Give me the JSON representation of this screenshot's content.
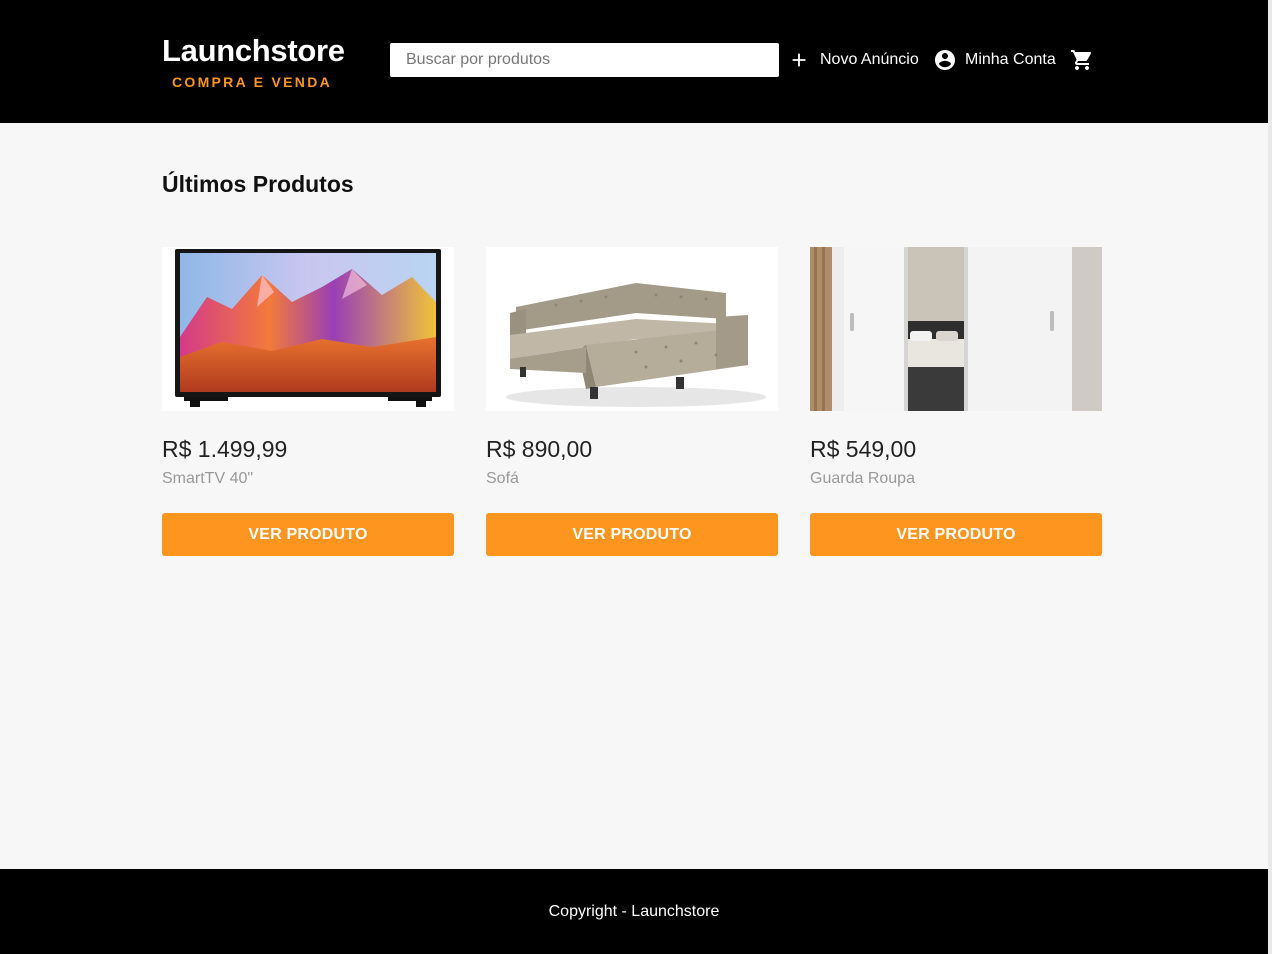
{
  "header": {
    "brand_title": "Launchstore",
    "brand_subtitle": "COMPRA E VENDA",
    "search_placeholder": "Buscar por produtos",
    "new_ad_label": "Novo Anúncio",
    "account_label": "Minha Conta",
    "icons": {
      "new_ad": "plus-icon",
      "account": "account-circle-icon",
      "cart": "cart-icon"
    }
  },
  "main": {
    "section_title": "Últimos Produtos",
    "products": [
      {
        "price": "R$ 1.499,99",
        "name": "SmartTV 40\"",
        "button": "VER PRODUTO",
        "image": "tv-image"
      },
      {
        "price": "R$ 890,00",
        "name": "Sofá",
        "button": "VER PRODUTO",
        "image": "sofa-image"
      },
      {
        "price": "R$ 549,00",
        "name": "Guarda Roupa",
        "button": "VER PRODUTO",
        "image": "wardrobe-image"
      }
    ]
  },
  "footer": {
    "copyright": "Copyright - Launchstore"
  },
  "colors": {
    "accent": "#fd951f",
    "header_bg": "#000000",
    "page_bg": "#f7f7f7",
    "muted_text": "#999999"
  }
}
